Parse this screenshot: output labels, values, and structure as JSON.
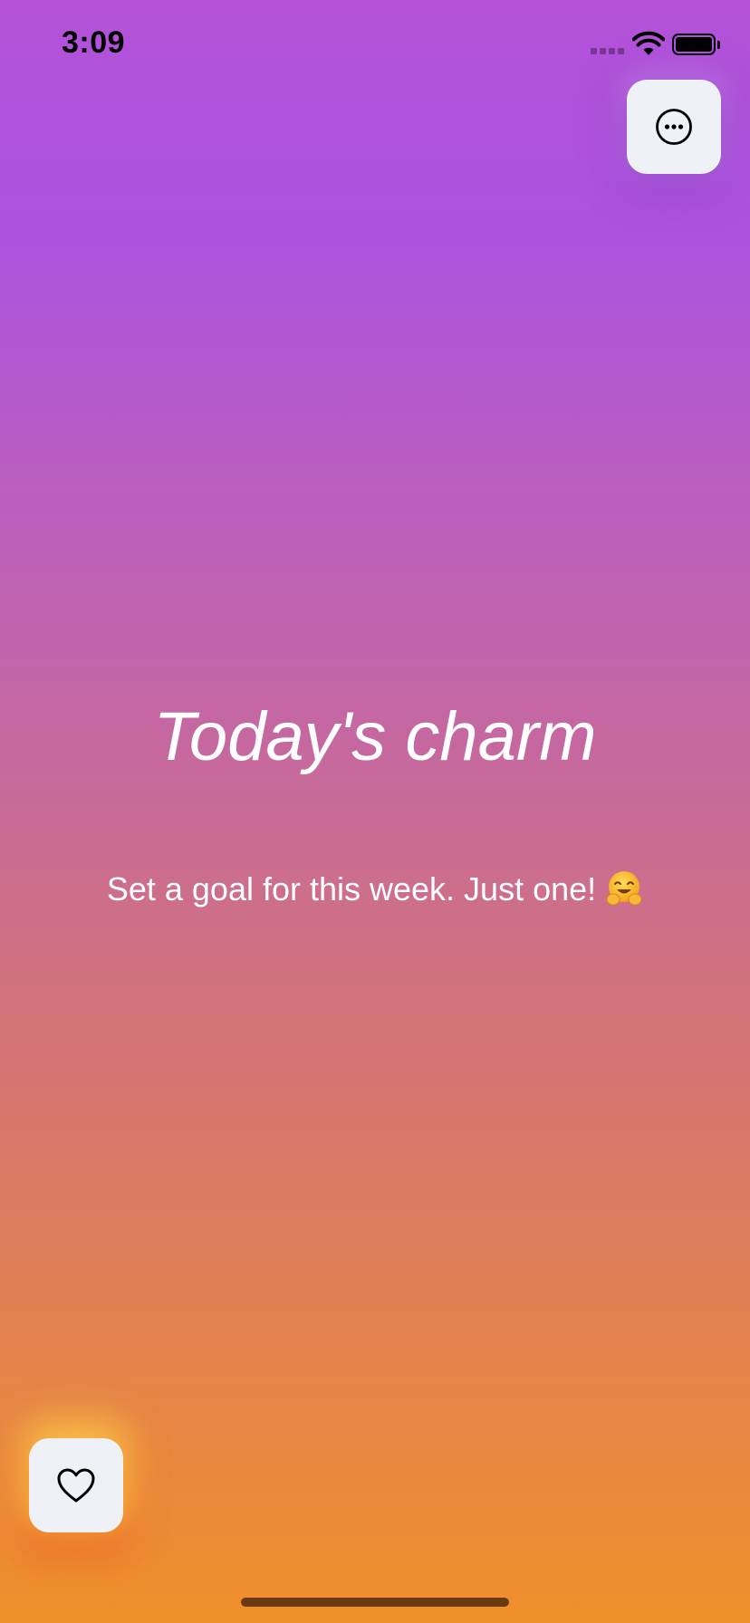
{
  "status_bar": {
    "time": "3:09",
    "icons": [
      "cellular-signal-icon",
      "wifi-icon",
      "battery-icon"
    ]
  },
  "header": {
    "menu_button_icon": "ellipsis-circle-icon"
  },
  "main": {
    "title": "Today's charm",
    "message": "Set a goal for this week. Just one!",
    "message_emoji": "hugging-face-emoji"
  },
  "footer": {
    "favorite_button_icon": "heart-outline-icon"
  },
  "colors": {
    "gradient_top": "#b352d8",
    "gradient_bottom": "#f0902a",
    "button_background": "#eef1f6",
    "text": "#ffffff"
  }
}
